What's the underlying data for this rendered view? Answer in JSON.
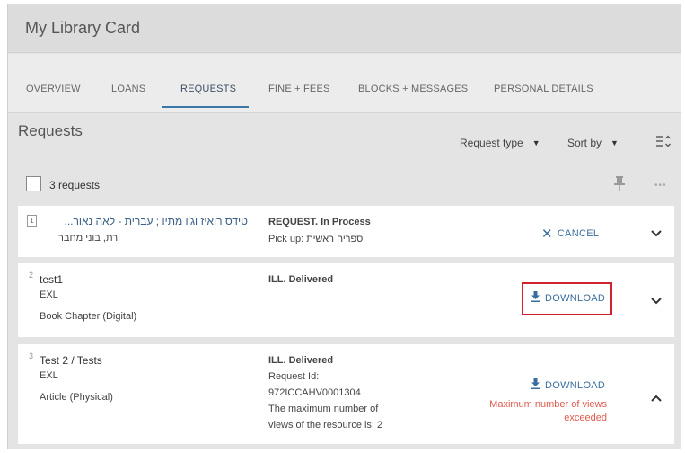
{
  "header": {
    "title": "My Library Card"
  },
  "tabs": [
    "OVERVIEW",
    "LOANS",
    "REQUESTS",
    "FINE + FEES",
    "BLOCKS + MESSAGES",
    "PERSONAL DETAILS"
  ],
  "active_tab": "REQUESTS",
  "section": {
    "title": "Requests",
    "request_type_label": "Request type",
    "sort_by_label": "Sort by",
    "count_label": "3 requests"
  },
  "requests": [
    {
      "number": "1",
      "title": "טידס רואיז וג'ו מתיו ; עברית - לאה נאור...",
      "subtitle": "ורת, בוני מחבר",
      "status": "REQUEST. In Process",
      "pickup": "Pick up: ספריה ראשית",
      "action": "CANCEL"
    },
    {
      "number": "2",
      "title": "test1",
      "subtitle": "EXL",
      "type": "Book Chapter (Digital)",
      "status": "ILL. Delivered",
      "action": "DOWNLOAD"
    },
    {
      "number": "3",
      "title": "Test 2 / Tests",
      "subtitle": "EXL",
      "type": "Article (Physical)",
      "status": "ILL. Delivered",
      "request_id_label": "Request Id:",
      "request_id": "972ICCAHV0001304",
      "views_note_line1": "The maximum number of",
      "views_note_line2": "views of the resource is: 2",
      "action": "DOWNLOAD",
      "warning_line1": "Maximum number of views",
      "warning_line2": "exceeded"
    }
  ],
  "colors": {
    "accent": "#3b6e9e",
    "warning": "#e05a4e",
    "highlight": "#d1222d"
  }
}
